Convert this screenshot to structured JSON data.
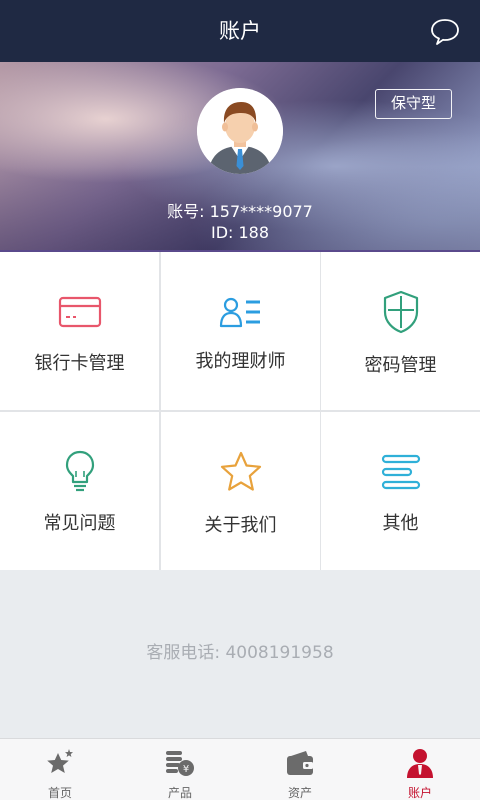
{
  "header": {
    "title": "账户",
    "message_icon": "chat-bubble-icon"
  },
  "profile": {
    "risk_level": "保守型",
    "account_label": "账号: 157****9077",
    "id_label": "ID: 188",
    "avatar_icon": "user-avatar-icon"
  },
  "menu": {
    "items": [
      {
        "label": "银行卡管理",
        "icon": "bank-card-icon",
        "color": "#e8566b"
      },
      {
        "label": "我的理财师",
        "icon": "advisor-icon",
        "color": "#2b9de0"
      },
      {
        "label": "密码管理",
        "icon": "shield-icon",
        "color": "#32a07c"
      },
      {
        "label": "常见问题",
        "icon": "lightbulb-icon",
        "color": "#32a07c"
      },
      {
        "label": "关于我们",
        "icon": "star-icon",
        "color": "#e8a23c"
      },
      {
        "label": "其他",
        "icon": "list-icon",
        "color": "#2fb0d8"
      }
    ]
  },
  "hotline": "客服电话: 4008191958",
  "tabbar": {
    "items": [
      {
        "label": "首页",
        "icon": "home-star-icon",
        "active": false
      },
      {
        "label": "产品",
        "icon": "coins-icon",
        "active": false
      },
      {
        "label": "资产",
        "icon": "wallet-icon",
        "active": false
      },
      {
        "label": "账户",
        "icon": "account-person-icon",
        "active": true
      }
    ],
    "active_color": "#c4122f"
  }
}
